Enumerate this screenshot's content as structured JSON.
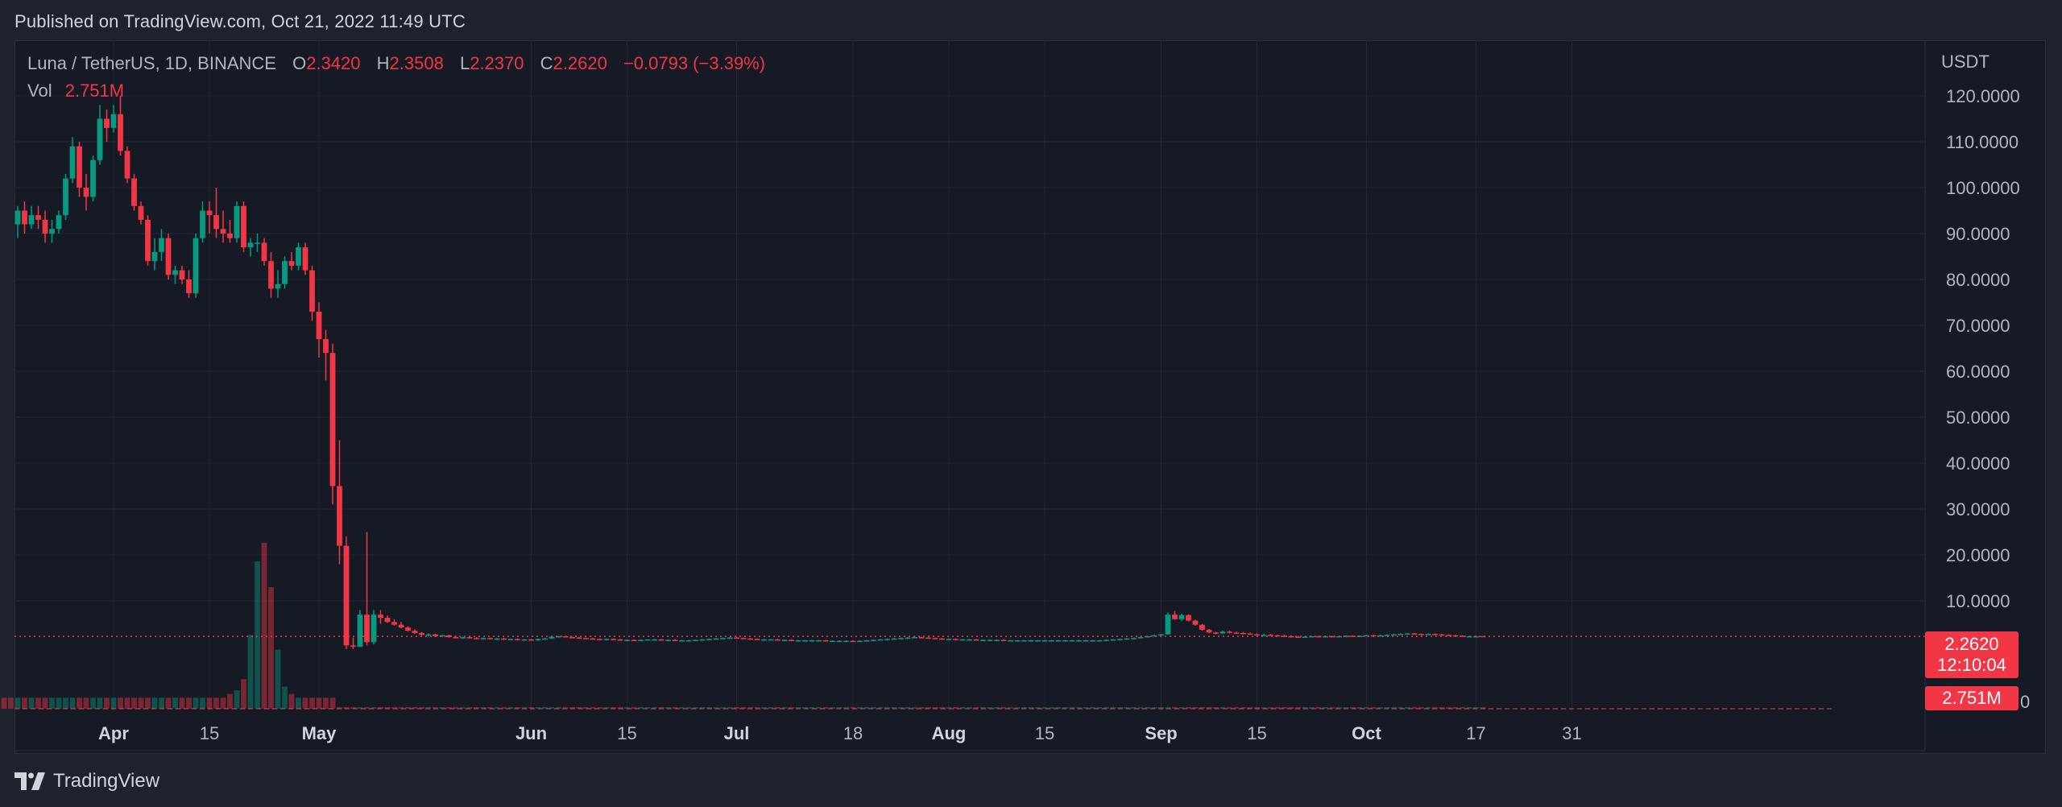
{
  "header": {
    "published": "Published on TradingView.com, Oct 21, 2022 11:49 UTC"
  },
  "legend": {
    "symbol": "Luna / TetherUS, 1D, BINANCE",
    "o_label": "O",
    "o_value": "2.3420",
    "h_label": "H",
    "h_value": "2.3508",
    "l_label": "L",
    "l_value": "2.2370",
    "c_label": "C",
    "c_value": "2.2620",
    "change": "−0.0793 (−3.39%)",
    "vol_label": "Vol",
    "vol_value": "2.751M"
  },
  "footer": {
    "brand": "TradingView"
  },
  "colors": {
    "up": "#089981",
    "down": "#f23645",
    "background": "#161a25",
    "grid": "#232734",
    "text": "#b2b5be"
  },
  "chart_data": {
    "type": "candlestick",
    "currency": "USDT",
    "y_ticks": [
      "120.0000",
      "110.0000",
      "100.0000",
      "90.0000",
      "80.0000",
      "70.0000",
      "60.0000",
      "50.0000",
      "40.0000",
      "30.0000",
      "20.0000",
      "10.0000"
    ],
    "y_tick_values": [
      120,
      110,
      100,
      90,
      80,
      70,
      60,
      50,
      40,
      30,
      20,
      10
    ],
    "ylim": [
      -14.2,
      132.1
    ],
    "x_ticks": [
      {
        "label": "Apr",
        "date": "2022-04-01",
        "bold": true
      },
      {
        "label": "15",
        "date": "2022-04-15",
        "bold": false
      },
      {
        "label": "May",
        "date": "2022-05-01",
        "bold": true
      },
      {
        "label": "Jun",
        "date": "2022-06-01",
        "bold": true
      },
      {
        "label": "15",
        "date": "2022-06-15",
        "bold": false
      },
      {
        "label": "Jul",
        "date": "2022-07-01",
        "bold": true
      },
      {
        "label": "18",
        "date": "2022-07-18",
        "bold": false
      },
      {
        "label": "Aug",
        "date": "2022-08-01",
        "bold": true
      },
      {
        "label": "15",
        "date": "2022-08-15",
        "bold": false
      },
      {
        "label": "Sep",
        "date": "2022-09-01",
        "bold": true
      },
      {
        "label": "15",
        "date": "2022-09-15",
        "bold": false
      },
      {
        "label": "Oct",
        "date": "2022-10-01",
        "bold": true
      },
      {
        "label": "17",
        "date": "2022-10-17",
        "bold": false
      },
      {
        "label": "31",
        "date": "2022-10-31",
        "bold": false
      }
    ],
    "start_date": "2022-03-18",
    "last_price": "2.2620",
    "last_price_value": 2.262,
    "countdown": "12:10:04",
    "last_volume": "2.751M",
    "volume_axis_label": "0",
    "candles": [
      [
        92,
        96,
        89,
        95
      ],
      [
        95,
        97,
        90,
        92
      ],
      [
        92,
        96,
        91,
        94
      ],
      [
        94,
        96,
        91,
        93
      ],
      [
        93,
        95,
        88,
        90
      ],
      [
        90,
        93,
        88,
        91
      ],
      [
        91,
        95,
        90,
        94
      ],
      [
        94,
        103,
        93,
        102
      ],
      [
        102,
        111,
        101,
        109
      ],
      [
        109,
        110,
        98,
        100
      ],
      [
        100,
        103,
        95,
        98
      ],
      [
        98,
        107,
        97,
        106
      ],
      [
        106,
        118,
        105,
        115
      ],
      [
        115,
        117,
        110,
        113
      ],
      [
        113,
        118,
        112,
        116
      ],
      [
        116,
        120,
        107,
        108
      ],
      [
        108,
        109,
        101,
        102
      ],
      [
        102,
        103,
        95,
        96
      ],
      [
        96,
        97,
        92,
        93
      ],
      [
        93,
        94,
        83,
        84
      ],
      [
        84,
        89,
        82,
        86
      ],
      [
        86,
        91,
        84,
        89
      ],
      [
        89,
        90,
        80,
        81
      ],
      [
        81,
        83,
        79,
        82
      ],
      [
        82,
        83,
        79,
        80
      ],
      [
        80,
        82,
        76,
        77
      ],
      [
        77,
        90,
        76,
        89
      ],
      [
        89,
        97,
        88,
        95
      ],
      [
        95,
        97,
        90,
        94
      ],
      [
        94,
        100,
        89,
        91
      ],
      [
        91,
        95,
        88,
        90
      ],
      [
        90,
        93,
        88,
        89
      ],
      [
        89,
        97,
        88,
        96
      ],
      [
        96,
        97,
        86,
        87
      ],
      [
        87,
        89,
        85,
        88
      ],
      [
        88,
        90,
        86,
        88
      ],
      [
        88,
        89,
        83,
        84
      ],
      [
        84,
        86,
        76,
        78
      ],
      [
        78,
        82,
        76,
        79
      ],
      [
        79,
        85,
        78,
        84
      ],
      [
        84,
        86,
        82,
        83
      ],
      [
        83,
        88,
        82,
        87
      ],
      [
        87,
        88,
        81,
        82
      ],
      [
        82,
        83,
        71,
        73
      ],
      [
        73,
        75,
        63,
        67
      ],
      [
        67,
        69,
        58,
        64
      ],
      [
        64,
        66,
        31,
        35
      ],
      [
        35,
        45,
        18,
        22
      ],
      [
        22,
        24,
        -0.5,
        0.3
      ],
      [
        0.3,
        2,
        -0.5,
        0.0015
      ],
      [
        0.002,
        8,
        0,
        7
      ],
      [
        7,
        25,
        0.3,
        1
      ],
      [
        1,
        8,
        0.5,
        7
      ],
      [
        7,
        8,
        5,
        6.3
      ],
      [
        6.3,
        6.8,
        5.2,
        5.4
      ],
      [
        5.4,
        6,
        4.6,
        4.8
      ],
      [
        4.8,
        5.4,
        4,
        4.2
      ],
      [
        4.2,
        4.5,
        3.3,
        3.5
      ],
      [
        3.5,
        3.8,
        2.8,
        3
      ],
      [
        3,
        3.2,
        2.4,
        2.6
      ],
      [
        2.6,
        2.9,
        2.2,
        2.7
      ],
      [
        2.7,
        2.8,
        2.2,
        2.3
      ],
      [
        2.3,
        2.6,
        2.1,
        2.5
      ],
      [
        2.5,
        2.6,
        2,
        2.1
      ],
      [
        2.1,
        2.3,
        1.9,
        2
      ],
      [
        2,
        2.2,
        1.8,
        2.1
      ],
      [
        2.1,
        2.2,
        1.8,
        1.9
      ],
      [
        1.9,
        2.1,
        1.7,
        1.8
      ],
      [
        1.8,
        2,
        1.6,
        1.9
      ],
      [
        1.9,
        2,
        1.6,
        1.7
      ],
      [
        1.7,
        1.9,
        1.5,
        1.8
      ],
      [
        1.8,
        1.9,
        1.5,
        1.6
      ],
      [
        1.6,
        1.8,
        1.4,
        1.7
      ],
      [
        1.7,
        1.8,
        1.4,
        1.5
      ],
      [
        1.5,
        1.7,
        1.3,
        1.6
      ],
      [
        1.6,
        1.7,
        1.3,
        1.4
      ],
      [
        1.4,
        1.8,
        1.3,
        1.7
      ],
      [
        1.7,
        1.9,
        1.6,
        1.8
      ],
      [
        1.8,
        2.3,
        1.7,
        2.2
      ],
      [
        2.2,
        2.4,
        2,
        2.3
      ],
      [
        2.3,
        2.4,
        2,
        2.1
      ],
      [
        2.1,
        2.2,
        1.9,
        2
      ],
      [
        2,
        2.1,
        1.8,
        1.9
      ],
      [
        1.9,
        2,
        1.7,
        1.8
      ],
      [
        1.8,
        1.9,
        1.6,
        1.7
      ],
      [
        1.7,
        1.8,
        1.5,
        1.6
      ],
      [
        1.6,
        1.8,
        1.5,
        1.7
      ],
      [
        1.7,
        1.8,
        1.5,
        1.6
      ],
      [
        1.6,
        1.7,
        1.4,
        1.5
      ],
      [
        1.5,
        1.6,
        1.4,
        1.5
      ],
      [
        1.5,
        1.6,
        1.3,
        1.4
      ],
      [
        1.4,
        1.6,
        1.3,
        1.5
      ],
      [
        1.5,
        1.6,
        1.4,
        1.6
      ],
      [
        1.6,
        1.7,
        1.5,
        1.6
      ],
      [
        1.6,
        1.7,
        1.4,
        1.5
      ],
      [
        1.5,
        1.6,
        1.4,
        1.5
      ],
      [
        1.5,
        1.6,
        1.3,
        1.4
      ],
      [
        1.4,
        1.5,
        1.3,
        1.4
      ],
      [
        1.4,
        1.5,
        1.3,
        1.4
      ],
      [
        1.4,
        1.6,
        1.3,
        1.5
      ],
      [
        1.5,
        1.7,
        1.4,
        1.6
      ],
      [
        1.6,
        1.8,
        1.5,
        1.7
      ],
      [
        1.7,
        1.9,
        1.6,
        1.8
      ],
      [
        1.8,
        2,
        1.7,
        1.9
      ],
      [
        1.9,
        2.1,
        1.8,
        2
      ],
      [
        2,
        2.2,
        1.8,
        1.9
      ],
      [
        1.9,
        2,
        1.7,
        1.8
      ],
      [
        1.8,
        1.9,
        1.6,
        1.7
      ],
      [
        1.7,
        1.8,
        1.5,
        1.6
      ],
      [
        1.6,
        1.7,
        1.5,
        1.6
      ],
      [
        1.6,
        1.7,
        1.5,
        1.6
      ],
      [
        1.6,
        1.7,
        1.4,
        1.5
      ],
      [
        1.5,
        1.6,
        1.4,
        1.5
      ],
      [
        1.5,
        1.6,
        1.3,
        1.4
      ],
      [
        1.4,
        1.5,
        1.3,
        1.4
      ],
      [
        1.4,
        1.5,
        1.3,
        1.4
      ],
      [
        1.4,
        1.5,
        1.3,
        1.4
      ],
      [
        1.4,
        1.5,
        1.3,
        1.4
      ],
      [
        1.4,
        1.5,
        1.2,
        1.3
      ],
      [
        1.3,
        1.4,
        1.2,
        1.3
      ],
      [
        1.3,
        1.4,
        1.2,
        1.3
      ],
      [
        1.3,
        1.4,
        1.2,
        1.3
      ],
      [
        1.3,
        1.4,
        1.1,
        1.2
      ],
      [
        1.2,
        1.4,
        1.1,
        1.3
      ],
      [
        1.3,
        1.5,
        1.2,
        1.4
      ],
      [
        1.4,
        1.6,
        1.3,
        1.5
      ],
      [
        1.5,
        1.7,
        1.4,
        1.6
      ],
      [
        1.6,
        1.8,
        1.5,
        1.7
      ],
      [
        1.7,
        1.9,
        1.6,
        1.8
      ],
      [
        1.8,
        2,
        1.7,
        1.9
      ],
      [
        1.9,
        2.1,
        1.8,
        2
      ],
      [
        2,
        2.2,
        1.9,
        2.1
      ],
      [
        2.1,
        2.2,
        1.9,
        2
      ],
      [
        2,
        2.1,
        1.8,
        1.9
      ],
      [
        1.9,
        2,
        1.7,
        1.8
      ],
      [
        1.8,
        1.9,
        1.6,
        1.7
      ],
      [
        1.7,
        1.8,
        1.6,
        1.7
      ],
      [
        1.7,
        1.8,
        1.5,
        1.6
      ],
      [
        1.6,
        1.7,
        1.5,
        1.6
      ],
      [
        1.6,
        1.7,
        1.5,
        1.6
      ],
      [
        1.6,
        1.7,
        1.4,
        1.5
      ],
      [
        1.5,
        1.6,
        1.4,
        1.5
      ],
      [
        1.5,
        1.6,
        1.4,
        1.5
      ],
      [
        1.5,
        1.6,
        1.4,
        1.5
      ],
      [
        1.5,
        1.6,
        1.3,
        1.4
      ],
      [
        1.4,
        1.5,
        1.3,
        1.4
      ],
      [
        1.4,
        1.5,
        1.3,
        1.4
      ],
      [
        1.4,
        1.5,
        1.3,
        1.4
      ],
      [
        1.4,
        1.5,
        1.3,
        1.4
      ],
      [
        1.4,
        1.5,
        1.3,
        1.4
      ],
      [
        1.4,
        1.5,
        1.3,
        1.4
      ],
      [
        1.4,
        1.5,
        1.3,
        1.4
      ],
      [
        1.4,
        1.5,
        1.3,
        1.4
      ],
      [
        1.4,
        1.5,
        1.3,
        1.4
      ],
      [
        1.4,
        1.5,
        1.3,
        1.4
      ],
      [
        1.4,
        1.5,
        1.3,
        1.4
      ],
      [
        1.4,
        1.5,
        1.3,
        1.4
      ],
      [
        1.4,
        1.5,
        1.3,
        1.4
      ],
      [
        1.4,
        1.5,
        1.3,
        1.4
      ],
      [
        1.4,
        1.6,
        1.3,
        1.5
      ],
      [
        1.5,
        1.7,
        1.4,
        1.6
      ],
      [
        1.6,
        1.8,
        1.5,
        1.7
      ],
      [
        1.7,
        1.9,
        1.6,
        1.8
      ],
      [
        1.8,
        2,
        1.7,
        1.9
      ],
      [
        1.9,
        2.2,
        1.8,
        2.1
      ],
      [
        2.1,
        2.4,
        2,
        2.3
      ],
      [
        2.3,
        2.6,
        2.2,
        2.5
      ],
      [
        2.5,
        2.8,
        2.4,
        2.7
      ],
      [
        2.7,
        7.5,
        2.6,
        7
      ],
      [
        7,
        7.8,
        5.9,
        6
      ],
      [
        6,
        7.2,
        5.6,
        6.9
      ],
      [
        6.9,
        7.1,
        5.5,
        5.7
      ],
      [
        5.7,
        5.9,
        4.6,
        4.8
      ],
      [
        4.8,
        5,
        3.5,
        3.7
      ],
      [
        3.7,
        3.9,
        3,
        3.1
      ],
      [
        3.1,
        3.3,
        2.7,
        2.9
      ],
      [
        2.9,
        3.5,
        2.8,
        3.3
      ],
      [
        3.3,
        3.5,
        2.9,
        3.1
      ],
      [
        3.1,
        3.3,
        2.8,
        3
      ],
      [
        3,
        3.2,
        2.7,
        2.9
      ],
      [
        2.9,
        3.1,
        2.6,
        2.7
      ],
      [
        2.7,
        2.9,
        2.5,
        2.6
      ],
      [
        2.6,
        2.8,
        2.4,
        2.6
      ],
      [
        2.6,
        2.8,
        2.4,
        2.5
      ],
      [
        2.5,
        2.6,
        2.3,
        2.4
      ],
      [
        2.4,
        2.6,
        2.2,
        2.3
      ],
      [
        2.3,
        2.5,
        2.1,
        2.2
      ],
      [
        2.2,
        2.4,
        2,
        2.1
      ],
      [
        2.1,
        2.3,
        2,
        2.2
      ],
      [
        2.2,
        2.4,
        2.1,
        2.3
      ],
      [
        2.3,
        2.4,
        2.1,
        2.2
      ],
      [
        2.2,
        2.4,
        2.1,
        2.3
      ],
      [
        2.3,
        2.4,
        2.1,
        2.2
      ],
      [
        2.2,
        2.4,
        2.1,
        2.3
      ],
      [
        2.3,
        2.5,
        2.2,
        2.4
      ],
      [
        2.4,
        2.5,
        2.2,
        2.3
      ],
      [
        2.3,
        2.5,
        2.2,
        2.4
      ],
      [
        2.4,
        2.6,
        2.3,
        2.5
      ],
      [
        2.5,
        2.6,
        2.3,
        2.4
      ],
      [
        2.4,
        2.6,
        2.3,
        2.5
      ],
      [
        2.5,
        2.7,
        2.4,
        2.6
      ],
      [
        2.6,
        2.8,
        2.5,
        2.7
      ],
      [
        2.7,
        2.9,
        2.6,
        2.8
      ],
      [
        2.8,
        3,
        2.7,
        2.9
      ],
      [
        2.9,
        3,
        2.7,
        2.8
      ],
      [
        2.8,
        2.9,
        2.6,
        2.7
      ],
      [
        2.7,
        2.9,
        2.6,
        2.8
      ],
      [
        2.8,
        2.9,
        2.6,
        2.7
      ],
      [
        2.7,
        2.8,
        2.5,
        2.6
      ],
      [
        2.6,
        2.7,
        2.4,
        2.5
      ],
      [
        2.5,
        2.6,
        2.3,
        2.4
      ],
      [
        2.4,
        2.5,
        2.2,
        2.3
      ],
      [
        2.3,
        2.4,
        2.2,
        2.3
      ],
      [
        2.3,
        2.4,
        2.2,
        2.3
      ],
      [
        2.342,
        2.3508,
        2.237,
        2.262
      ]
    ],
    "volumes": [
      0.2,
      0.2,
      0.2,
      0.2,
      0.2,
      0.2,
      0.2,
      0.3,
      0.3,
      0.3,
      0.3,
      0.3,
      0.3,
      0.3,
      0.3,
      0.3,
      0.3,
      0.3,
      0.3,
      0.3,
      0.3,
      0.3,
      0.3,
      0.3,
      0.3,
      0.3,
      0.3,
      0.3,
      0.3,
      0.3,
      0.3,
      0.3,
      0.3,
      0.3,
      0.3,
      0.3,
      0.3,
      0.3,
      0.3,
      0.3,
      0.3,
      0.3,
      0.3,
      0.3,
      0.4,
      0.5,
      0.8,
      2,
      4,
      4.5,
      3.3,
      1.6,
      0.6,
      0.4,
      0.3,
      0.3,
      0.3,
      0.3,
      0.3,
      0.3
    ]
  }
}
